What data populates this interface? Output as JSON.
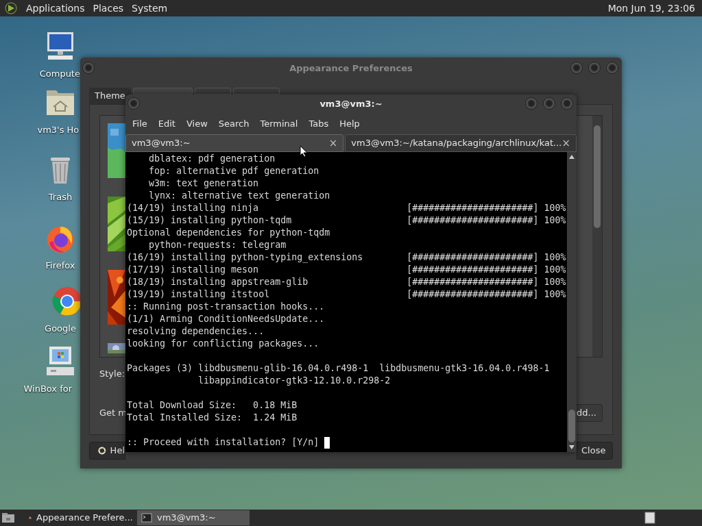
{
  "top_panel": {
    "menus": [
      "Applications",
      "Places",
      "System"
    ],
    "clock": "Mon Jun 19, 23:06"
  },
  "desktop_icons": [
    {
      "kind": "computer",
      "label": "Compute"
    },
    {
      "kind": "home-folder",
      "label": "vm3's Ho"
    },
    {
      "kind": "trash",
      "label": "Trash"
    },
    {
      "kind": "fox-browser",
      "label": "Firefox"
    },
    {
      "kind": "ring-browser",
      "label": "Google"
    },
    {
      "kind": "old-pc",
      "label": "WinBox for"
    }
  ],
  "appearance_window": {
    "title": "Appearance Preferences",
    "tabs": [
      {
        "label": "Theme",
        "selected": false
      }
    ],
    "style_label": "Style:",
    "get_more_label": "Get m",
    "add_button": "dd...",
    "help_button": "Hel",
    "close_button": "Close"
  },
  "terminal_window": {
    "title": "vm3@vm3:~",
    "menus": [
      "File",
      "Edit",
      "View",
      "Search",
      "Terminal",
      "Tabs",
      "Help"
    ],
    "tabs": [
      {
        "label": "vm3@vm3:~",
        "close": "×",
        "selected": true
      },
      {
        "label": "vm3@vm3:~/katana/packaging/archlinux/kat...",
        "close": "×",
        "selected": false
      }
    ],
    "output_blocks": [
      [
        "    dblatex: pdf generation",
        "    fop: alternative pdf generation",
        "    w3m: text generation",
        "    lynx: alternative text generation",
        "(14/19) installing ninja                           [######################] 100%",
        "(15/19) installing python-tqdm                     [######################] 100%",
        "Optional dependencies for python-tqdm",
        "    python-requests: telegram",
        "(16/19) installing python-typing_extensions        [######################] 100%",
        "(17/19) installing meson                           [######################] 100%",
        "(18/19) installing appstream-glib                  [######################] 100%",
        "(19/19) installing itstool                         [######################] 100%",
        ":: Running post-transaction hooks...",
        "(1/1) Arming ConditionNeedsUpdate...",
        "resolving dependencies...",
        "looking for conflicting packages..."
      ],
      [
        "Packages (3) libdbusmenu-glib-16.04.0.r498-1  libdbusmenu-gtk3-16.04.0.r498-1",
        "             libappindicator-gtk3-12.10.0.r298-2"
      ],
      [
        "Total Download Size:   0.18 MiB",
        "Total Installed Size:  1.24 MiB"
      ],
      [
        ":: Proceed with installation? [Y/n] "
      ]
    ]
  },
  "taskbar": {
    "items": [
      {
        "label": "Appearance Prefere...",
        "selected": false
      },
      {
        "label": "vm3@vm3:~",
        "selected": true
      }
    ]
  }
}
